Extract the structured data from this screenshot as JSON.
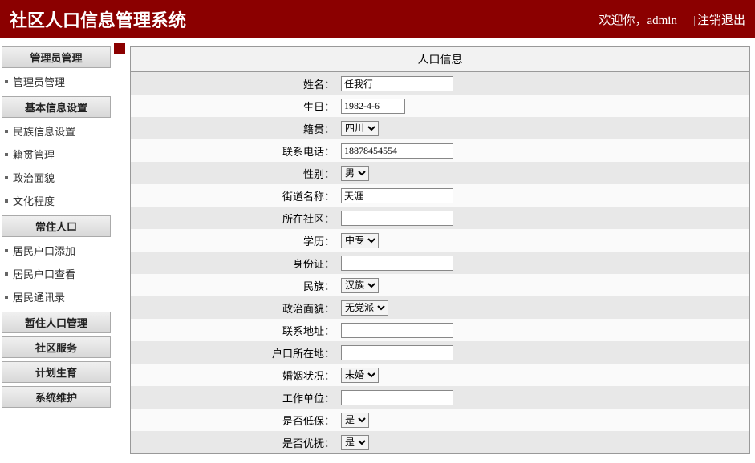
{
  "header": {
    "title": "社区人口信息管理系统",
    "welcome_prefix": "欢迎你，",
    "username": "admin",
    "logout": "注销退出"
  },
  "sidebar": {
    "sections": [
      {
        "header": "管理员管理",
        "items": [
          "管理员管理"
        ]
      },
      {
        "header": "基本信息设置",
        "items": [
          "民族信息设置",
          "籍贯管理",
          "政治面貌",
          "文化程度"
        ]
      },
      {
        "header": "常住人口",
        "items": [
          "居民户口添加",
          "居民户口查看",
          "居民通讯录"
        ]
      },
      {
        "header": "暂住人口管理",
        "items": []
      },
      {
        "header": "社区服务",
        "items": []
      },
      {
        "header": "计划生育",
        "items": []
      },
      {
        "header": "系统维护",
        "items": []
      }
    ]
  },
  "form": {
    "title": "人口信息",
    "rows": [
      {
        "label": "姓名：",
        "type": "text",
        "value": "任我行"
      },
      {
        "label": "生日：",
        "type": "text",
        "value": "1982-4-6",
        "short": true
      },
      {
        "label": "籍贯：",
        "type": "select",
        "value": "四川"
      },
      {
        "label": "联系电话：",
        "type": "text",
        "value": "18878454554"
      },
      {
        "label": "性别：",
        "type": "select",
        "value": "男"
      },
      {
        "label": "街道名称：",
        "type": "text",
        "value": "天涯"
      },
      {
        "label": "所在社区：",
        "type": "text",
        "value": ""
      },
      {
        "label": "学历：",
        "type": "select",
        "value": "中专"
      },
      {
        "label": "身份证：",
        "type": "text",
        "value": ""
      },
      {
        "label": "民族：",
        "type": "select",
        "value": "汉族"
      },
      {
        "label": "政治面貌：",
        "type": "select",
        "value": "无党派"
      },
      {
        "label": "联系地址：",
        "type": "text",
        "value": ""
      },
      {
        "label": "户口所在地：",
        "type": "text",
        "value": ""
      },
      {
        "label": "婚姻状况：",
        "type": "select",
        "value": "未婚"
      },
      {
        "label": "工作单位：",
        "type": "text",
        "value": ""
      },
      {
        "label": "是否低保：",
        "type": "select",
        "value": "是"
      },
      {
        "label": "是否优抚：",
        "type": "select",
        "value": "是"
      }
    ]
  }
}
